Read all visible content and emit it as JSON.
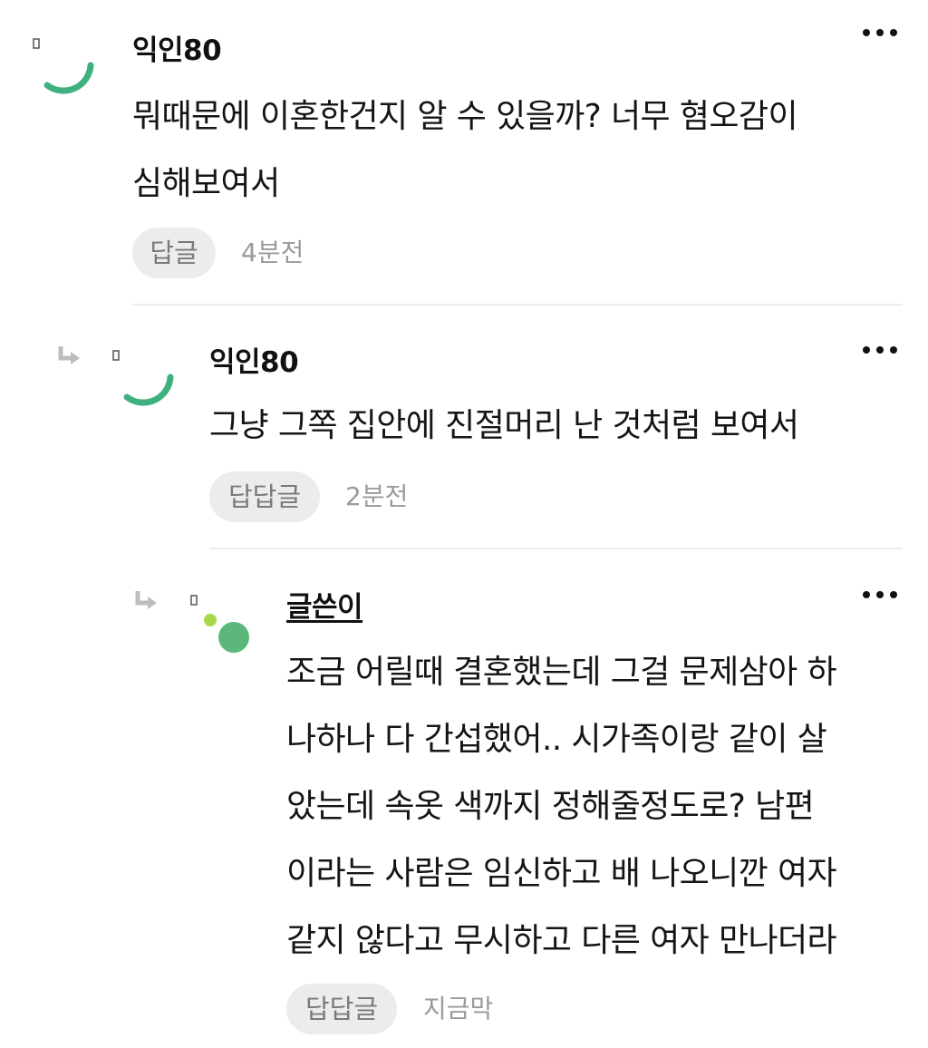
{
  "colors": {
    "avatar_green": "#3fb07f",
    "op_dot_green": "#5cb87a",
    "op_dot_lime": "#a8d84a",
    "button_bg": "#ececec",
    "timestamp": "#9a9a9a"
  },
  "comments": [
    {
      "author": "익인80",
      "text": "뭐때문에 이혼한건지 알 수 있을까? 너무 혐오감이\n심해보여서",
      "reply_label": "답글",
      "time": "4분전",
      "icons": {
        "avatar": "avatar-icon",
        "more": "more-icon"
      }
    },
    {
      "author": "익인80",
      "text": "그냥 그쪽 집안에 진절머리 난 것처럼 보여서",
      "reply_label": "답답글",
      "time": "2분전",
      "icons": {
        "reply_arrow": "reply-arrow-icon",
        "avatar": "avatar-icon",
        "more": "more-icon"
      }
    },
    {
      "author": "글쓴이",
      "text": "조금 어릴때 결혼했는데 그걸 문제삼아 하\n나하나 다 간섭했어.. 시가족이랑 같이 살\n았는데 속옷 색까지 정해줄정도로? 남편\n이라는 사람은 임신하고 배 나오니깐 여자\n같지 않다고 무시하고 다른 여자 만나더라",
      "reply_label": "답답글",
      "time": "지금막",
      "icons": {
        "reply_arrow": "reply-arrow-icon",
        "avatar": "author-avatar-icon",
        "more": "more-icon"
      }
    }
  ]
}
